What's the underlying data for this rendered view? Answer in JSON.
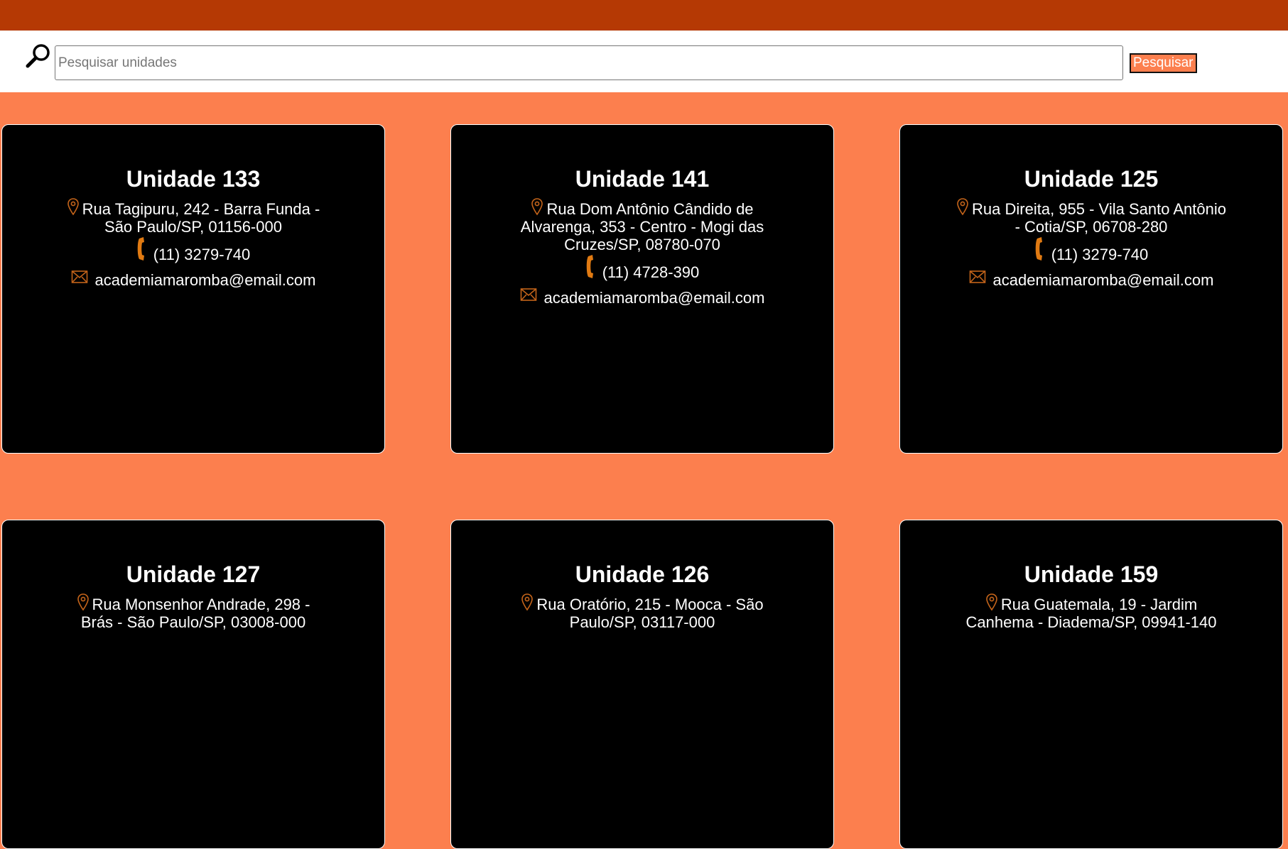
{
  "search": {
    "placeholder": "Pesquisar unidades",
    "value": "",
    "button_label": "Pesquisar"
  },
  "colors": {
    "top_bar": "#b53904",
    "page_background": "#fc7f4e",
    "card_background": "#000000",
    "icon_accent": "#e07a12"
  },
  "units": [
    {
      "title": "Unidade 133",
      "address": "Rua Tagipuru, 242 - Barra Funda - São Paulo/SP, 01156-000",
      "phone": "(11) 3279-740",
      "email": "academiamaromba@email.com"
    },
    {
      "title": "Unidade 141",
      "address": "Rua Dom Antônio Cândido de Alvarenga, 353 - Centro - Mogi das Cruzes/SP, 08780-070",
      "phone": "(11) 4728-390",
      "email": "academiamaromba@email.com"
    },
    {
      "title": "Unidade 125",
      "address": "Rua Direita, 955 - Vila Santo Antônio - Cotia/SP, 06708-280",
      "phone": "(11) 3279-740",
      "email": "academiamaromba@email.com"
    },
    {
      "title": "Unidade 127",
      "address": "Rua Monsenhor Andrade, 298 - Brás - São Paulo/SP, 03008-000",
      "phone": "",
      "email": ""
    },
    {
      "title": "Unidade 126",
      "address": "Rua Oratório, 215 - Mooca - São Paulo/SP, 03117-000",
      "phone": "",
      "email": ""
    },
    {
      "title": "Unidade 159",
      "address": "Rua Guatemala, 19 - Jardim Canhema - Diadema/SP, 09941-140",
      "phone": "",
      "email": ""
    }
  ],
  "icons": {
    "search": "magnifier-icon",
    "address": "location-pin-icon",
    "phone": "phone-icon",
    "email": "envelope-icon"
  }
}
